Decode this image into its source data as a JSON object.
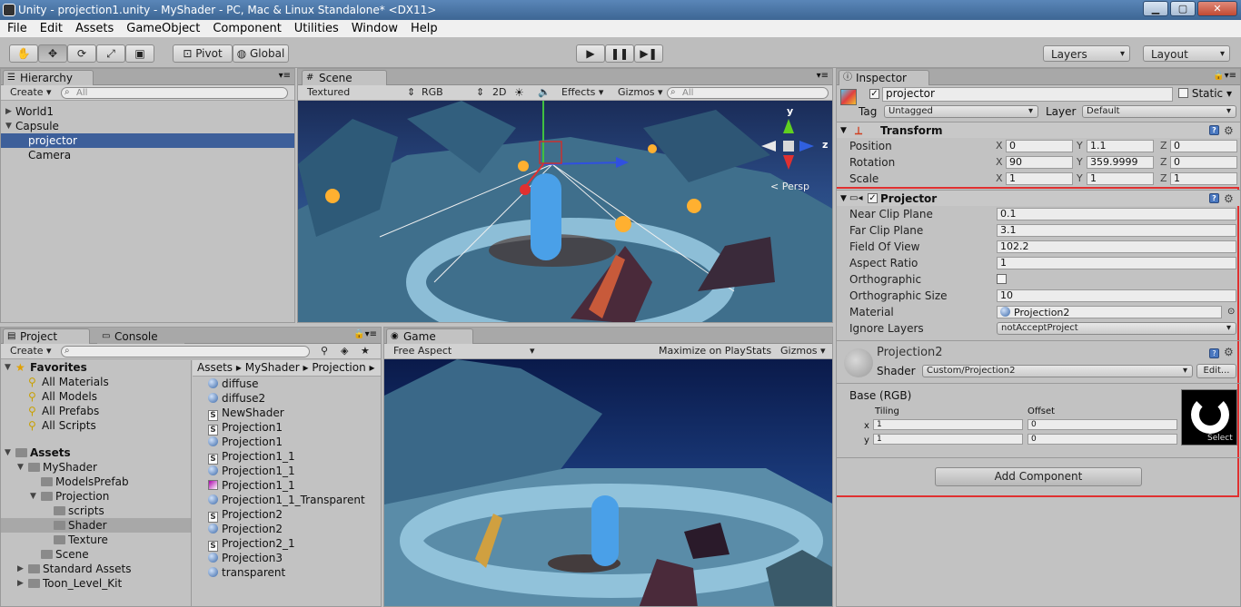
{
  "window": {
    "title": "Unity - projection1.unity - MyShader - PC, Mac & Linux Standalone* <DX11>",
    "minimize": "▁",
    "maximize": "▢",
    "close": "✕"
  },
  "menu": [
    "File",
    "Edit",
    "Assets",
    "GameObject",
    "Component",
    "Utilities",
    "Window",
    "Help"
  ],
  "toolbar": {
    "pivot": "Pivot",
    "global": "Global",
    "layers": "Layers",
    "layout": "Layout"
  },
  "hierarchy": {
    "tab": "Hierarchy",
    "create": "Create",
    "search": "All",
    "items": [
      "World1",
      "Capsule",
      "projector",
      "Camera"
    ]
  },
  "scene": {
    "tab": "Scene",
    "shading": "Textured",
    "rgb": "RGB",
    "mode2d": "2D",
    "effects": "Effects",
    "gizmos": "Gizmos",
    "search": "All",
    "persp": "Persp",
    "axis_y": "y",
    "axis_z": "z"
  },
  "game": {
    "tab": "Game",
    "aspect": "Free Aspect",
    "maximize": "Maximize on Play",
    "stats": "Stats",
    "gizmos": "Gizmos"
  },
  "project": {
    "tab": "Project",
    "console_tab": "Console",
    "create": "Create",
    "favorites_label": "Favorites",
    "favorites": [
      "All Materials",
      "All Models",
      "All Prefabs",
      "All Scripts"
    ],
    "assets_label": "Assets",
    "folders": [
      "MyShader",
      "ModelsPrefab",
      "Projection",
      "scripts",
      "Shader",
      "Texture",
      "Scene",
      "Standard Assets",
      "Toon_Level_Kit"
    ],
    "breadcrumb": [
      "Assets",
      "MyShader",
      "Projection"
    ],
    "files": [
      {
        "name": "diffuse",
        "kind": "ball"
      },
      {
        "name": "diffuse2",
        "kind": "ball"
      },
      {
        "name": "NewShader",
        "kind": "shader"
      },
      {
        "name": "Projection1",
        "kind": "shader"
      },
      {
        "name": "Projection1",
        "kind": "ball"
      },
      {
        "name": "Projection1_1",
        "kind": "shader"
      },
      {
        "name": "Projection1_1",
        "kind": "ball"
      },
      {
        "name": "Projection1_1",
        "kind": "material"
      },
      {
        "name": "Projection1_1_Transparent",
        "kind": "ball"
      },
      {
        "name": "Projection2",
        "kind": "shader"
      },
      {
        "name": "Projection2",
        "kind": "ball"
      },
      {
        "name": "Projection2_1",
        "kind": "shader"
      },
      {
        "name": "Projection3",
        "kind": "ball"
      },
      {
        "name": "transparent",
        "kind": "ball"
      }
    ]
  },
  "inspector": {
    "tab": "Inspector",
    "object_name": "projector",
    "static_label": "Static",
    "tag_label": "Tag",
    "tag_value": "Untagged",
    "layer_label": "Layer",
    "layer_value": "Default",
    "transform": {
      "title": "Transform",
      "position_label": "Position",
      "position": {
        "x": "0",
        "y": "1.1",
        "z": "0"
      },
      "rotation_label": "Rotation",
      "rotation": {
        "x": "90",
        "y": "359.9999",
        "z": "0"
      },
      "scale_label": "Scale",
      "scale": {
        "x": "1",
        "y": "1",
        "z": "1"
      }
    },
    "projector": {
      "title": "Projector",
      "rows": [
        {
          "label": "Near Clip Plane",
          "value": "0.1"
        },
        {
          "label": "Far Clip Plane",
          "value": "3.1"
        },
        {
          "label": "Field Of View",
          "value": "102.2"
        },
        {
          "label": "Aspect Ratio",
          "value": "1"
        },
        {
          "label": "Orthographic",
          "value": ""
        },
        {
          "label": "Orthographic Size",
          "value": "10"
        },
        {
          "label": "Material",
          "value": "Projection2"
        },
        {
          "label": "Ignore Layers",
          "value": "notAcceptProject"
        }
      ]
    },
    "material": {
      "name": "Projection2",
      "shader_label": "Shader",
      "shader_value": "Custom/Projection2",
      "edit": "Edit...",
      "base_label": "Base (RGB)",
      "tiling": "Tiling",
      "offset": "Offset",
      "tiling_x": "1",
      "tiling_y": "1",
      "offset_x": "0",
      "offset_y": "0",
      "select": "Select"
    },
    "add_component": "Add Component"
  },
  "colors": {
    "highlight": "#e03030",
    "selection": "#3d5f9a"
  }
}
